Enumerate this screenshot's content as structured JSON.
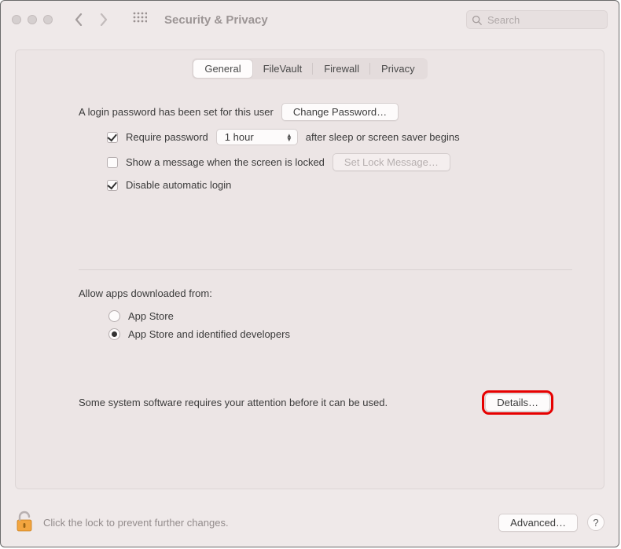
{
  "window": {
    "title": "Security & Privacy",
    "search_placeholder": "Search"
  },
  "tabs": {
    "general": "General",
    "filevault": "FileVault",
    "firewall": "Firewall",
    "privacy": "Privacy",
    "active": "general"
  },
  "general": {
    "login_password_line": "A login password has been set for this user",
    "change_password_button": "Change Password…",
    "require_password": {
      "checked": true,
      "label_before": "Require password",
      "delay_value": "1 hour",
      "label_after": "after sleep or screen saver begins"
    },
    "show_message": {
      "checked": false,
      "label": "Show a message when the screen is locked",
      "set_button": "Set Lock Message…"
    },
    "disable_auto_login": {
      "checked": true,
      "label": "Disable automatic login"
    },
    "allow_apps": {
      "heading": "Allow apps downloaded from:",
      "options": {
        "app_store": "App Store",
        "identified": "App Store and identified developers"
      },
      "selected": "identified"
    },
    "attention": {
      "message": "Some system software requires your attention before it can be used.",
      "details_button": "Details…"
    }
  },
  "footer": {
    "lock_hint": "Click the lock to prevent further changes.",
    "advanced_button": "Advanced…",
    "help_label": "?"
  }
}
